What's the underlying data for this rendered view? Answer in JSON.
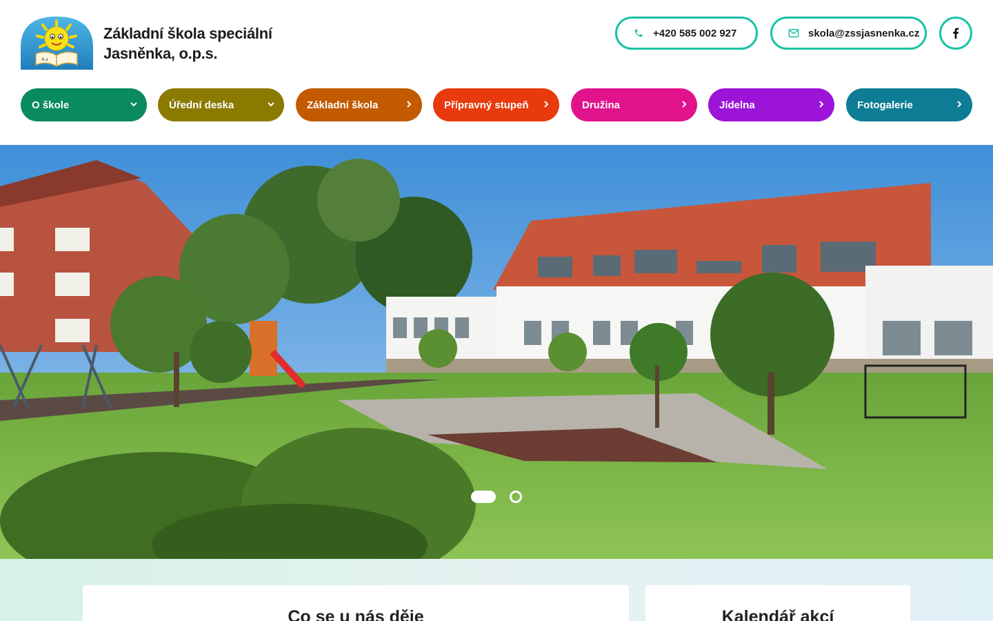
{
  "header": {
    "school_name_line1": "Základní škola speciální",
    "school_name_line2": "Jasněnka, o.p.s.",
    "logo_icon": "sun-book-logo-icon",
    "phone": "+420 585 002 927",
    "email": "skola@zssjasnenka.cz",
    "facebook_icon": "facebook-icon",
    "accent_color": "#19c2a4"
  },
  "nav": {
    "items": [
      {
        "label": "O škole",
        "color": "#0a8a5f",
        "icon": "chevron-down-icon"
      },
      {
        "label": "Úřední deska",
        "color": "#8a7a00",
        "icon": "chevron-down-icon"
      },
      {
        "label": "Základní škola",
        "color": "#c25a00",
        "icon": "chevron-right-icon"
      },
      {
        "label": "Přípravný stupeň",
        "color": "#e83a0d",
        "icon": "chevron-right-icon"
      },
      {
        "label": "Družina",
        "color": "#e0138c",
        "icon": "chevron-right-icon"
      },
      {
        "label": "Jídelna",
        "color": "#9b14d8",
        "icon": "chevron-right-icon"
      },
      {
        "label": "Fotogalerie",
        "color": "#0e7c95",
        "icon": "chevron-right-icon"
      }
    ]
  },
  "hero": {
    "slides_total": 2,
    "active_slide": 1
  },
  "sections": {
    "news_title": "Co se u nás děje",
    "calendar_title": "Kalendář akcí"
  }
}
